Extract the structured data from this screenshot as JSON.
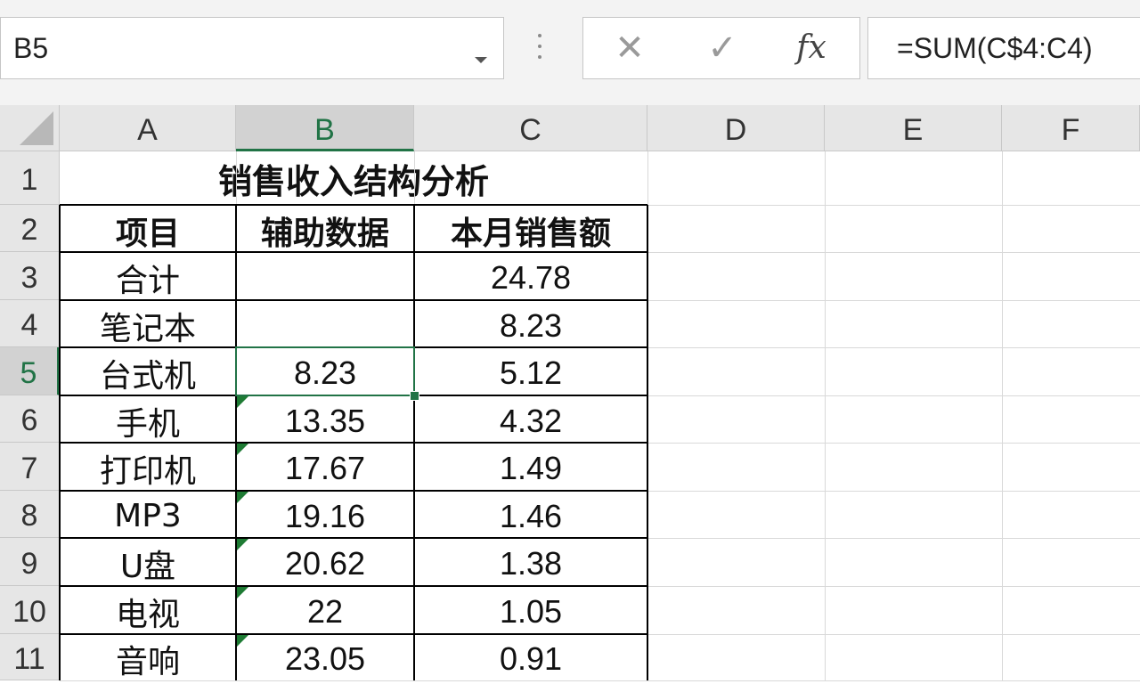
{
  "name_box": {
    "value": "B5"
  },
  "formula_bar": {
    "cancel_icon": "close-icon",
    "confirm_icon": "check-icon",
    "function_icon": "fx-icon",
    "cancel_glyph": "✕",
    "confirm_glyph": "✓",
    "function_glyph": "fx",
    "formula": "=SUM(C$4:C4)"
  },
  "active_cell": "B5",
  "accent_color": "#217346",
  "columns": [
    "A",
    "B",
    "C",
    "D",
    "E",
    "F"
  ],
  "rows": [
    "1",
    "2",
    "3",
    "4",
    "5",
    "6",
    "7",
    "8",
    "9",
    "10",
    "11"
  ],
  "sheet": {
    "title": "销售收入结构分析",
    "headers": {
      "item": "项目",
      "aux": "辅助数据",
      "sales": "本月销售额"
    },
    "data": [
      {
        "item": "合计",
        "aux": "",
        "sales": "24.78"
      },
      {
        "item": "笔记本",
        "aux": "",
        "sales": "8.23"
      },
      {
        "item": "台式机",
        "aux": "8.23",
        "sales": "5.12"
      },
      {
        "item": "手机",
        "aux": "13.35",
        "sales": "4.32"
      },
      {
        "item": "打印机",
        "aux": "17.67",
        "sales": "1.49"
      },
      {
        "item": "MP3",
        "aux": "19.16",
        "sales": "1.46"
      },
      {
        "item": "U盘",
        "aux": "20.62",
        "sales": "1.38"
      },
      {
        "item": "电视",
        "aux": "22",
        "sales": "1.05"
      },
      {
        "item": "音响",
        "aux": "23.05",
        "sales": "0.91"
      }
    ]
  }
}
